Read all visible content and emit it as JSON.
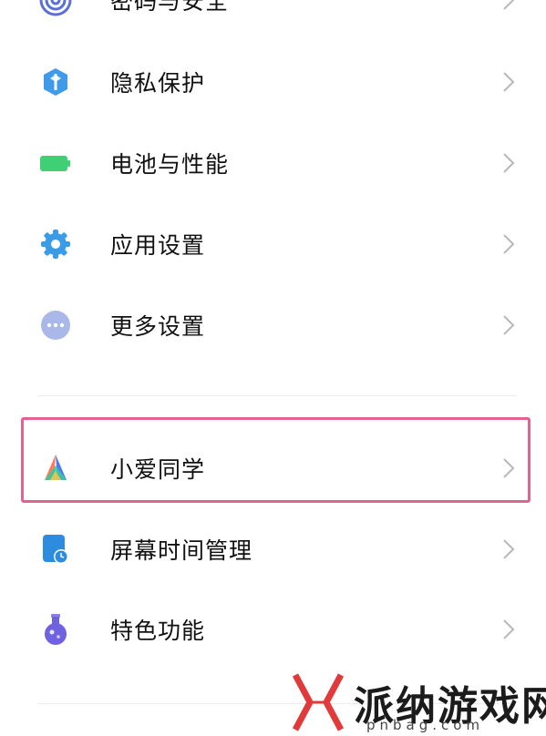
{
  "settings_items": [
    {
      "label": "密码与安全",
      "icon": "fingerprint-icon"
    },
    {
      "label": "隐私保护",
      "icon": "privacy-shield-icon"
    },
    {
      "label": "电池与性能",
      "icon": "battery-icon"
    },
    {
      "label": "应用设置",
      "icon": "gear-icon"
    },
    {
      "label": "更多设置",
      "icon": "more-dots-icon"
    },
    {
      "label": "小爱同学",
      "icon": "xiaoai-assistant-icon"
    },
    {
      "label": "屏幕时间管理",
      "icon": "screen-time-icon"
    },
    {
      "label": "特色功能",
      "icon": "flask-icon"
    }
  ],
  "watermark": {
    "text": "派纳游戏网",
    "url": "pnbag.com"
  },
  "colors": {
    "highlight_border": "#e3628e",
    "privacy_icon": "#3f9bea",
    "battery_icon": "#3fcf74",
    "gear_icon": "#3a9be6",
    "more_icon": "#a9b8e8",
    "screen_time_icon": "#2e8ce0",
    "flask_icon": "#6f62e0",
    "chevron": "#b8b8b8"
  }
}
